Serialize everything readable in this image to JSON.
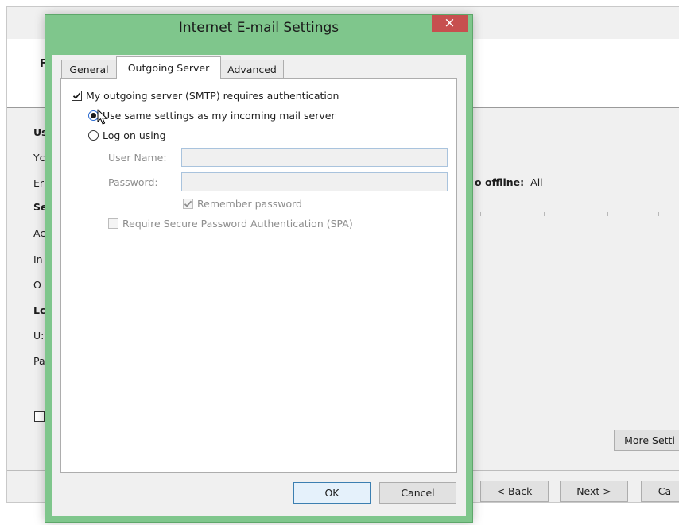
{
  "background": {
    "header_letter": "F",
    "labels": [
      {
        "text": "Us",
        "bold": true
      },
      {
        "text": "Yc",
        "bold": false
      },
      {
        "text": "Er",
        "bold": false
      },
      {
        "text": "Se",
        "bold": true
      },
      {
        "text": "Ac",
        "bold": false
      },
      {
        "text": "In",
        "bold": false
      },
      {
        "text": "O",
        "bold": false
      },
      {
        "text": "Lc",
        "bold": true
      },
      {
        "text": "U:",
        "bold": false
      },
      {
        "text": "Pa",
        "bold": false
      }
    ],
    "offline_label": "o offline:",
    "offline_value": "All",
    "more_settings_label": "More Setti",
    "back_label": "< Back",
    "next_label": "Next >",
    "cancel_partial_label": "Ca"
  },
  "dialog": {
    "title": "Internet E-mail Settings",
    "close_glyph": "×",
    "tabs": [
      {
        "label": "General",
        "active": false
      },
      {
        "label": "Outgoing Server",
        "active": true
      },
      {
        "label": "Advanced",
        "active": false
      }
    ],
    "smtp_auth": {
      "label": "My outgoing server (SMTP) requires authentication",
      "checked": true
    },
    "use_same": {
      "label": "Use same settings as my incoming mail server",
      "selected": true
    },
    "log_on": {
      "label": "Log on using",
      "selected": false
    },
    "user_name": {
      "label": "User Name:",
      "value": ""
    },
    "password": {
      "label": "Password:",
      "value": ""
    },
    "remember": {
      "label": "Remember password",
      "checked": true
    },
    "spa": {
      "label": "Require Secure Password Authentication (SPA)",
      "checked": false
    },
    "ok_label": "OK",
    "cancel_label": "Cancel"
  },
  "colors": {
    "dialog_frame": "#7fc68c",
    "close_button": "#c74f4f",
    "default_button_border": "#3c7fb1"
  }
}
